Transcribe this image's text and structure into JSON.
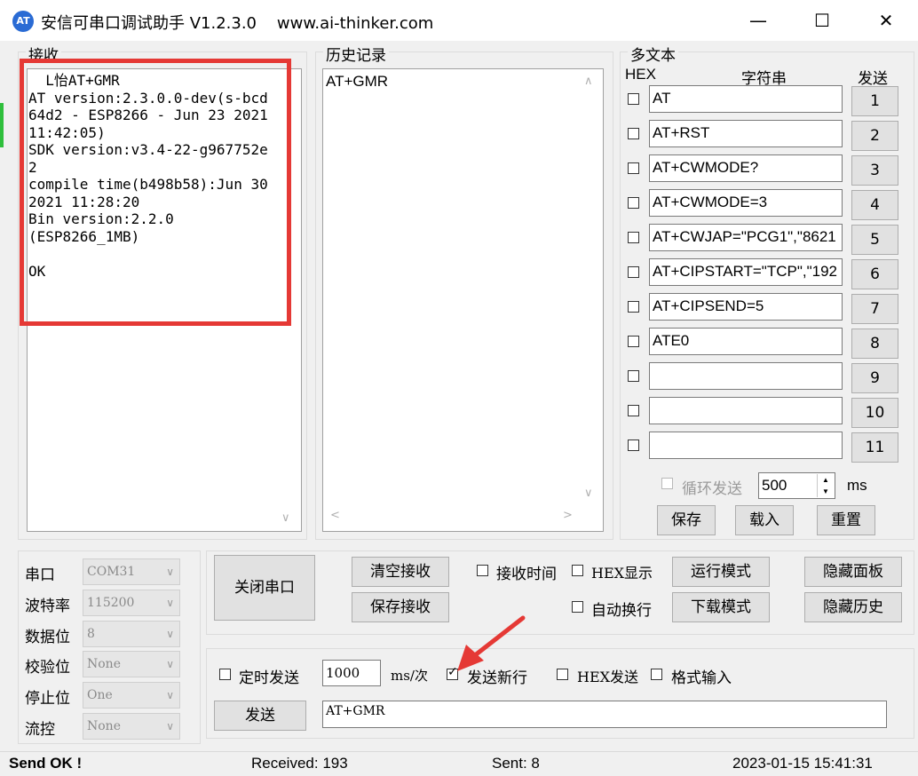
{
  "window": {
    "title": "安信可串口调试助手 V1.2.3.0    www.ai-thinker.com",
    "icon_text": "AT",
    "minimize_glyph": "—",
    "maximize_glyph": "☐",
    "close_glyph": "✕"
  },
  "receive": {
    "group_title": "接收",
    "text": "  L怡AT+GMR\nAT version:2.3.0.0-dev(s-bcd64d2 - ESP8266 - Jun 23 2021 11:42:05)\nSDK version:v3.4-22-g967752e2\ncompile time(b498b58):Jun 30 2021 11:28:20\nBin version:2.2.0\n(ESP8266_1MB)\n\nOK",
    "highlight_color": "#e53935"
  },
  "history": {
    "group_title": "历史记录",
    "items": [
      "AT+GMR"
    ]
  },
  "multitext": {
    "group_title": "多文本",
    "col_hex": "HEX",
    "col_string": "字符串",
    "col_send": "发送",
    "rows": [
      {
        "value": "AT",
        "button": "1"
      },
      {
        "value": "AT+RST",
        "button": "2"
      },
      {
        "value": "AT+CWMODE?",
        "button": "3"
      },
      {
        "value": "AT+CWMODE=3",
        "button": "4"
      },
      {
        "value": "AT+CWJAP=\"PCG1\",\"8621",
        "button": "5"
      },
      {
        "value": "AT+CIPSTART=\"TCP\",\"192",
        "button": "6"
      },
      {
        "value": "AT+CIPSEND=5",
        "button": "7"
      },
      {
        "value": "ATE0",
        "button": "8"
      },
      {
        "value": "",
        "button": "9"
      },
      {
        "value": "",
        "button": "10"
      },
      {
        "value": "",
        "button": "11"
      }
    ],
    "loop_label": "循环发送",
    "loop_interval": "500",
    "loop_unit": "ms",
    "save_label": "保存",
    "load_label": "载入",
    "reset_label": "重置"
  },
  "port": {
    "port_label": "串口",
    "port_value": "COM31",
    "baud_label": "波特率",
    "baud_value": "115200",
    "data_label": "数据位",
    "data_value": "8",
    "parity_label": "校验位",
    "parity_value": "None",
    "stop_label": "停止位",
    "stop_value": "One",
    "flow_label": "流控",
    "flow_value": "None"
  },
  "controls": {
    "close_port": "关闭串口",
    "clear_receive": "清空接收",
    "save_receive": "保存接收",
    "receive_time": "接收时间",
    "hex_display": "HEX显示",
    "auto_wrap": "自动换行",
    "run_mode": "运行模式",
    "download_mode": "下载模式",
    "hide_panel": "隐藏面板",
    "hide_history": "隐藏历史"
  },
  "send": {
    "timed_send": "定时发送",
    "interval": "1000",
    "interval_unit": "ms/次",
    "send_newline": "发送新行",
    "send_newline_checked": true,
    "hex_send": "HEX发送",
    "format_input": "格式输入",
    "send_button": "发送",
    "input_value": "AT+GMR",
    "arrow_color": "#e53935"
  },
  "status": {
    "send_ok": "Send OK !",
    "received": "Received: 193",
    "sent": "Sent: 8",
    "datetime": "2023-01-15 15:41:31"
  }
}
